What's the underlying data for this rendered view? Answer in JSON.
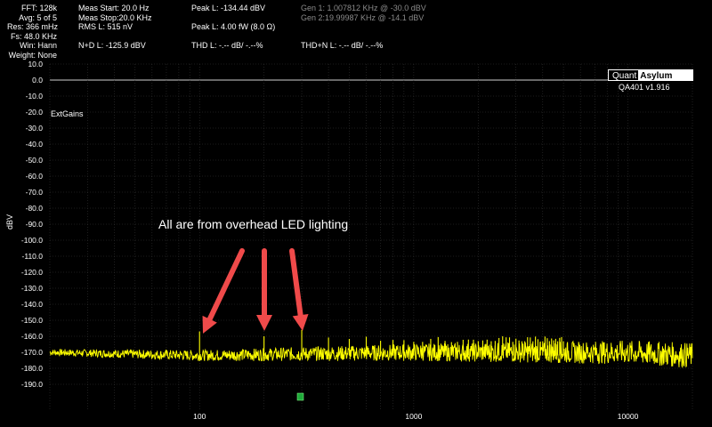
{
  "stats": {
    "col1": [
      "FFT: 128k",
      "Avg: 5 of 5",
      "Res: 366 mHz",
      "Fs: 48.0 KHz",
      "Win: Hann",
      "Weight: None"
    ],
    "col2": [
      "Meas Start: 20.0 Hz",
      "Meas Stop:20.0 KHz",
      "RMS L: 515 nV"
    ],
    "col3": [
      "Peak L: -134.44 dBV",
      "Peak L: 4.00 fW (8.0 Ω)"
    ],
    "col4": [
      "Gen 1: 1.007812 KHz @ -30.0  dBV",
      "Gen 2:19.99987 KHz @ -14.1  dBV"
    ],
    "nd": "N+D L: -125.9 dBV",
    "thd": "THD L: -.-- dB/ -.--%",
    "thdn": "THD+N L: -.-- dB/ -.--%"
  },
  "brand": {
    "quant": "Quant",
    "asylum": "Asylum",
    "version": "QA401 v1.916"
  },
  "plot": {
    "series_label": "ExtGains",
    "annotation": "All are from overhead LED lighting",
    "ylabel": "dBV",
    "trace_color": "#ffff00",
    "arrow_color": "#f04a4a",
    "y_ticks": [
      "10.0",
      "0.0",
      "-10.0",
      "-20.0",
      "-30.0",
      "-40.0",
      "-50.0",
      "-60.0",
      "-70.0",
      "-80.0",
      "-90.0",
      "-100.0",
      "-110.0",
      "-120.0",
      "-130.0",
      "-140.0",
      "-150.0",
      "-160.0",
      "-170.0",
      "-180.0",
      "-190.0"
    ],
    "x_ticks": [
      "100",
      "1000",
      "10000"
    ]
  },
  "chart_data": {
    "type": "line",
    "ylabel": "dBV",
    "xscale": "log",
    "xlim": [
      20,
      20000
    ],
    "ylim": [
      -195,
      10
    ],
    "grid": true,
    "series": [
      {
        "noise_floor_dbv_at_hz": {
          "20": -170,
          "100": -172,
          "1000": -170,
          "10000": -170,
          "20000": -172
        }
      }
    ],
    "annotated_spurs_hz": [
      100,
      200,
      300
    ],
    "spur_levels_dbv": [
      -157,
      -160,
      -156
    ]
  }
}
